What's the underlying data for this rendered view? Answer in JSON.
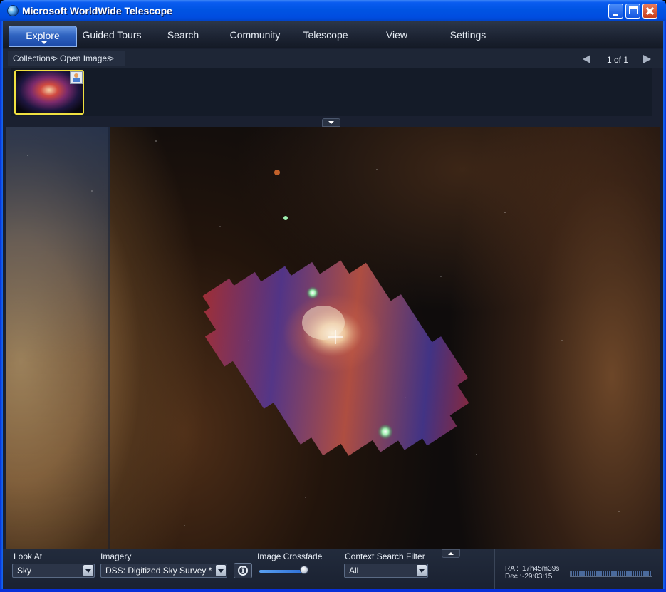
{
  "window": {
    "title": "Microsoft WorldWide Telescope",
    "titlebar_color": "#0054e3"
  },
  "menu": {
    "items": [
      {
        "label": "Explore",
        "active": true
      },
      {
        "label": "Guided Tours",
        "active": false
      },
      {
        "label": "Search",
        "active": false
      },
      {
        "label": "Community",
        "active": false
      },
      {
        "label": "Telescope",
        "active": false
      },
      {
        "label": "View",
        "active": false
      },
      {
        "label": "Settings",
        "active": false
      }
    ]
  },
  "breadcrumb": {
    "items": [
      "Collections",
      "Open Images"
    ],
    "separator": ">",
    "pager": "1 of 1"
  },
  "thumbnails": [
    {
      "selected": true,
      "icon": "image-badge-icon"
    }
  ],
  "view": {
    "crosshair": true,
    "overlay_mosaic_colors": [
      "#c4302a",
      "#5a3a9c",
      "#f4e6c8"
    ]
  },
  "controls": {
    "look_at": {
      "label": "Look At",
      "value": "Sky"
    },
    "imagery": {
      "label": "Imagery",
      "value": "DSS: Digitized Sky Survey *"
    },
    "crossfade": {
      "label": "Image Crossfade",
      "value": 0.95
    },
    "context_filter": {
      "label": "Context Search Filter",
      "value": "All"
    }
  },
  "status": {
    "ra_label": "RA :",
    "ra_value": "17h45m39s",
    "dec_label": "Dec :",
    "dec_value": "-29:03:15"
  }
}
